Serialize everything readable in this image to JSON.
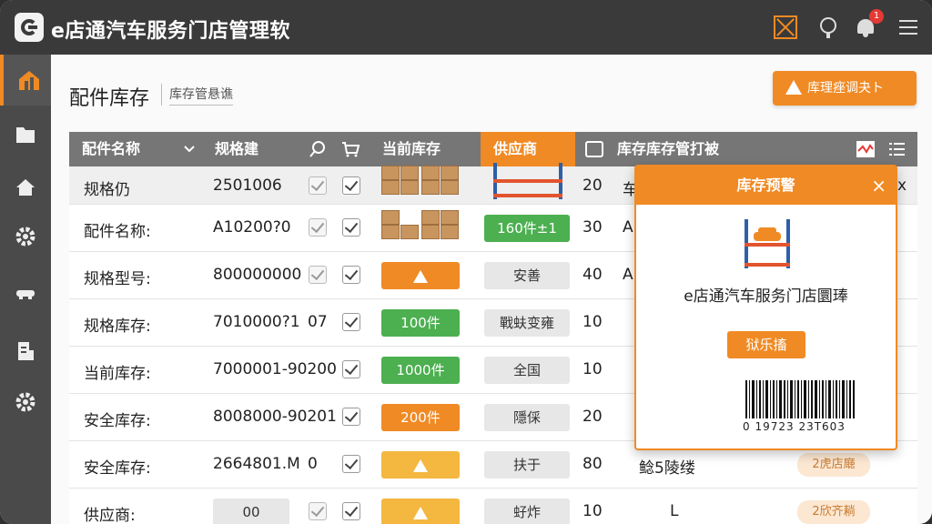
{
  "app": {
    "title": "e店通汽车服务门店管理软",
    "notification_count": "1",
    "accent": "#f08a24",
    "icons": [
      "logo-icon",
      "warehouse-icon",
      "location-icon",
      "bell-icon",
      "menu-icon"
    ]
  },
  "sidebar": {
    "items": [
      {
        "name": "dashboard-icon",
        "active": true
      },
      {
        "name": "folder-icon"
      },
      {
        "name": "home-icon"
      },
      {
        "name": "gear-icon"
      },
      {
        "name": "car-icon"
      },
      {
        "name": "report-icon"
      },
      {
        "name": "settings-icon"
      }
    ]
  },
  "page": {
    "title": "配件库存",
    "subtitle": "库存管悬谯",
    "alert_button": "库理痤调夬ト"
  },
  "table": {
    "headers": {
      "name": "配件名称",
      "spec": "规格建",
      "current": "当前库存",
      "supplier": "供应商",
      "mgmt": "库存库存管打被"
    },
    "rows": [
      {
        "name": "规格仍",
        "spec": "2501006",
        "num": "20",
        "col9": "车",
        "last": "x"
      },
      {
        "name": "配件名称:",
        "spec": "A10200?0",
        "status": "160件±1",
        "num": "30",
        "col9": "A"
      },
      {
        "name": "规格型号:",
        "spec": "800000000",
        "supplier": "安善",
        "num": "40",
        "col9": "A"
      },
      {
        "name": "规格库存:",
        "spec": "7010000?1",
        "extra": "07",
        "qty": "100件",
        "supplier": "戰蚨变雍",
        "num": "10"
      },
      {
        "name": "当前库存:",
        "spec": "7000001-90200",
        "qty": "1000件",
        "supplier": "全国",
        "num": "10"
      },
      {
        "name": "安全库存:",
        "spec": "8008000-90201",
        "qty": "200件",
        "supplier": "隱倸",
        "num": "20"
      },
      {
        "name": "安全库存:",
        "spec": "2664801.M",
        "extra": "0",
        "supplier": "扶于",
        "num": "80",
        "col9": "鲶5陵缕",
        "last": "2虎店廰"
      },
      {
        "name": "供应商:",
        "spec": "00",
        "supplier": "虸炸",
        "num": "10",
        "col9": "L",
        "last": "2欣齐耥"
      }
    ]
  },
  "popup": {
    "title": "库存预警",
    "message": "e店通汽车服务门店圜琫",
    "button": "狱乐搐",
    "barcode": "0 19723 23T603"
  }
}
